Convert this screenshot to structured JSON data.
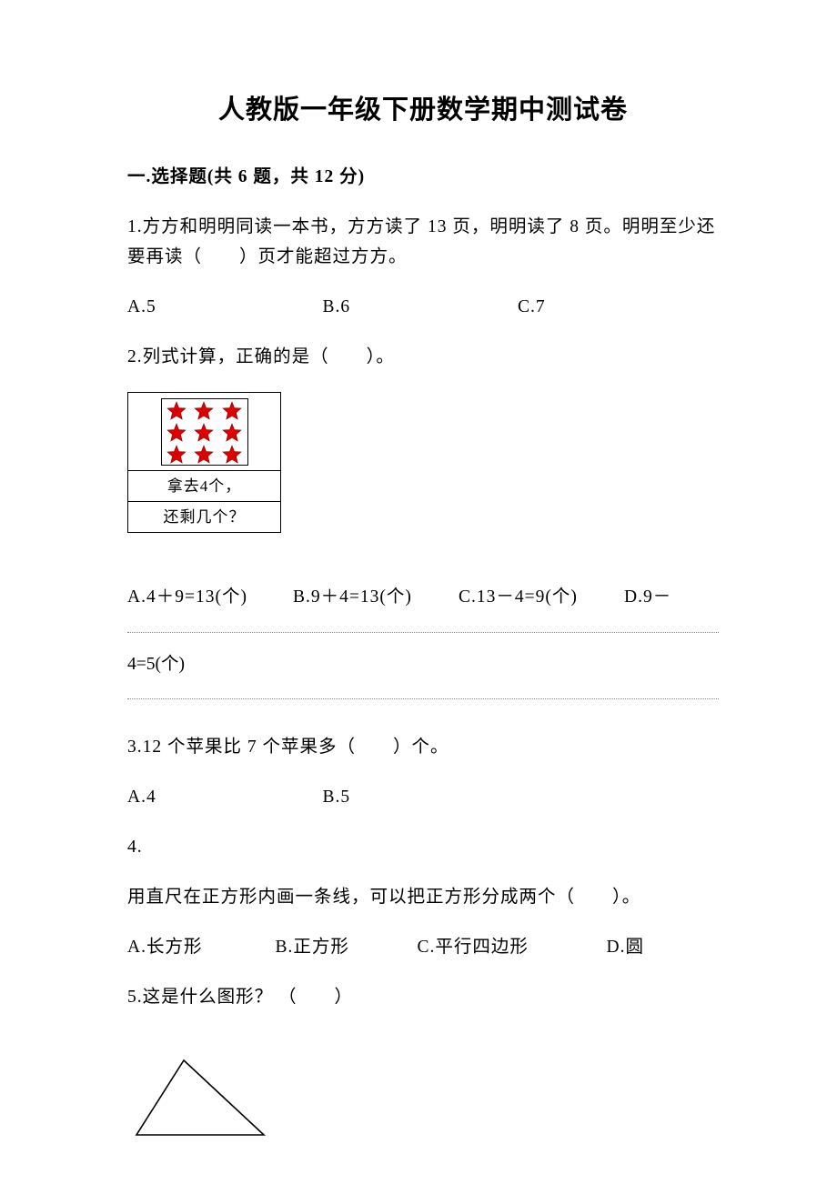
{
  "title": "人教版一年级下册数学期中测试卷",
  "section1": {
    "header": "一.选择题(共 6 题，共 12 分)"
  },
  "q1": {
    "text": "1.方方和明明同读一本书，方方读了 13 页，明明读了 8 页。明明至少还要再读（　　）页才能超过方方。",
    "a": "A.5",
    "b": "B.6",
    "c": "C.7"
  },
  "q2": {
    "text": "2.列式计算，正确的是（　　）。",
    "row1": "拿去4个，",
    "row2": "还剩几个？",
    "a": "A.4＋9=13(个)",
    "b": "B.9＋4=13(个)",
    "c": "C.13－4=9(个)",
    "d": "D.9－",
    "cont": "4=5(个)"
  },
  "q3": {
    "text": "3.12 个苹果比 7 个苹果多（　　）个。",
    "a": "A.4",
    "b": "B.5"
  },
  "q4": {
    "num": "4.",
    "text": "用直尺在正方形内画一条线，可以把正方形分成两个（　　）。",
    "a": "A.长方形",
    "b": "B.正方形",
    "c": "C.平行四边形",
    "d": "D.圆"
  },
  "q5": {
    "text": "5.这是什么图形？ （　　）"
  }
}
